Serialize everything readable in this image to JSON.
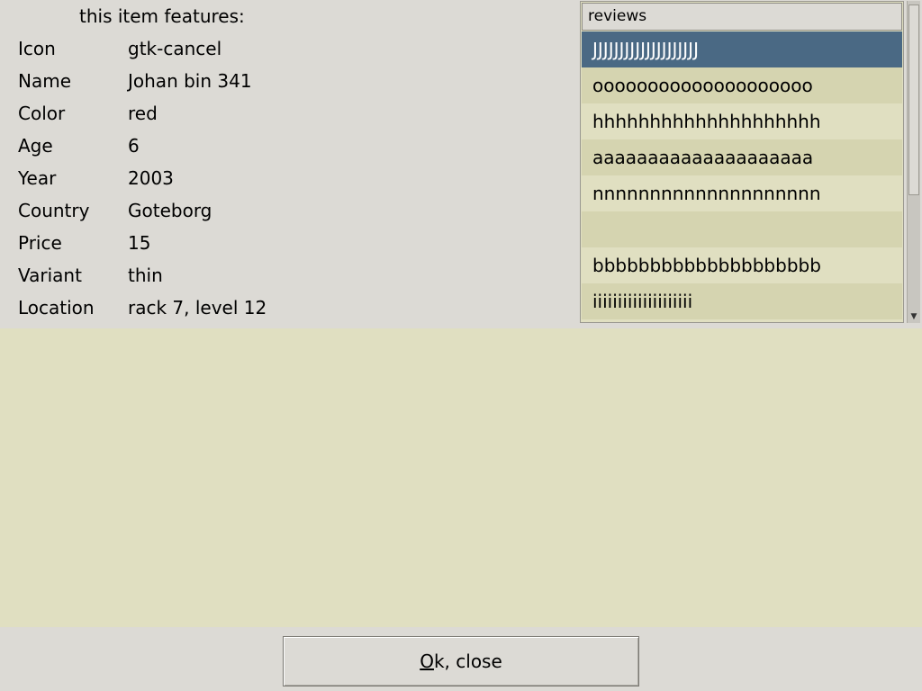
{
  "features": {
    "title": "this item features:",
    "rows": [
      {
        "key": "Icon",
        "value": "gtk-cancel"
      },
      {
        "key": "Name",
        "value": "Johan bin 341"
      },
      {
        "key": "Color",
        "value": "red"
      },
      {
        "key": "Age",
        "value": "6"
      },
      {
        "key": "Year",
        "value": "2003"
      },
      {
        "key": "Country",
        "value": "Goteborg"
      },
      {
        "key": "Price",
        "value": "15"
      },
      {
        "key": "Variant",
        "value": "thin"
      },
      {
        "key": "Location",
        "value": "rack 7, level 12"
      }
    ]
  },
  "reviews": {
    "header": "reviews",
    "selected_index": 0,
    "items": [
      "JJJJJJJJJJJJJJJJJJJJ",
      "oooooooooooooooooooo",
      "hhhhhhhhhhhhhhhhhhhh",
      "aaaaaaaaaaaaaaaaaaaa",
      "nnnnnnnnnnnnnnnnnnnn",
      "",
      "bbbbbbbbbbbbbbbbbbbb",
      "iiiiiiiiiiiiiiiiiiii"
    ]
  },
  "scrollbar": {
    "down_arrow": "▼"
  },
  "button": {
    "ok_mnemonic": "O",
    "ok_rest": "k, close"
  },
  "colors": {
    "window_bg": "#dcdad5",
    "list_bg": "#e0dfc1",
    "list_alt_bg": "#d5d4b0",
    "selection_bg": "#4a6984",
    "selection_fg": "#ffffff"
  }
}
